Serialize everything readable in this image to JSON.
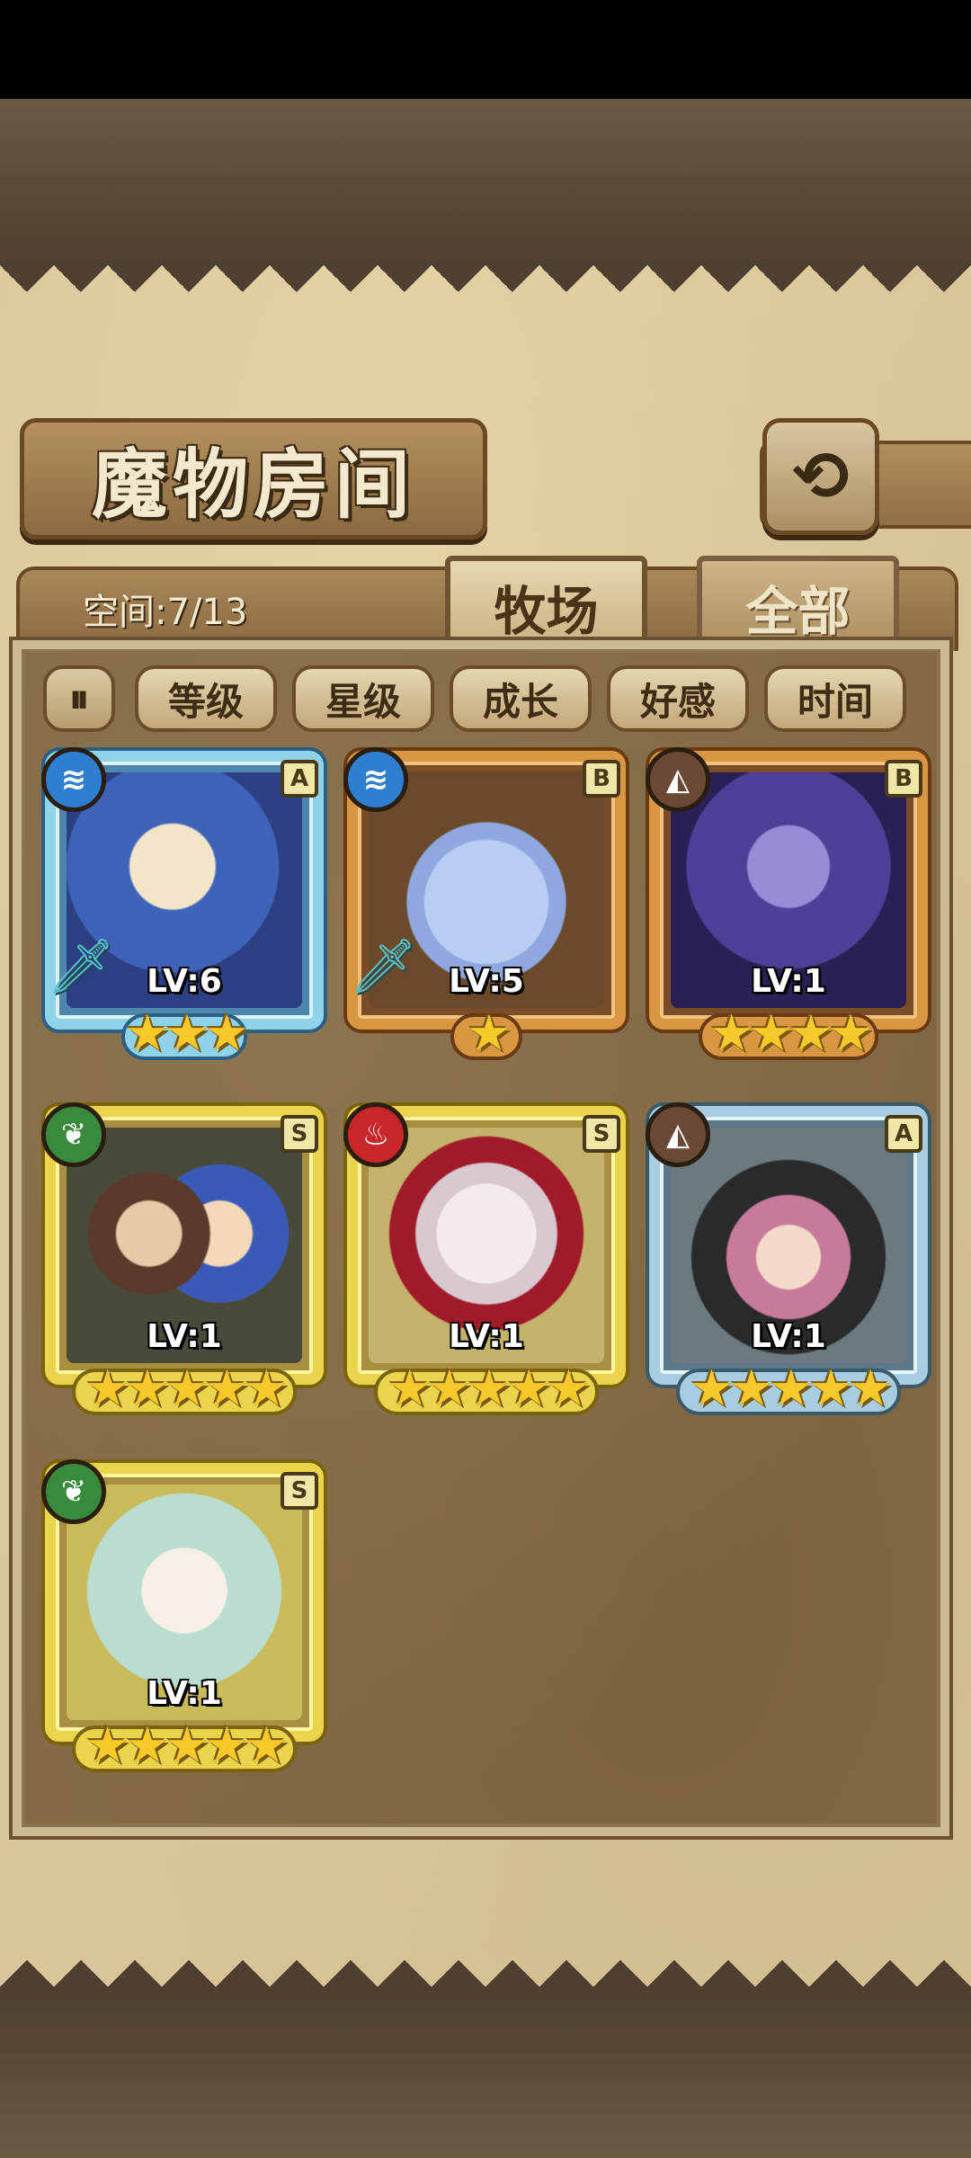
{
  "screen": {
    "title": "魔物房间",
    "back_icon": "⟲",
    "space_label": "空间:7/13"
  },
  "tabs": [
    {
      "label": "牧场",
      "active": true
    },
    {
      "label": "全部",
      "active": false
    }
  ],
  "sort": {
    "toggle_icon": "⏸",
    "buttons": [
      "等级",
      "星级",
      "成长",
      "好感",
      "时间"
    ]
  },
  "cards": [
    {
      "level": "LV:6",
      "rank": "A",
      "element": "water",
      "element_icon": "≋",
      "stars": 3,
      "frame": "blue",
      "has_weapon": true
    },
    {
      "level": "LV:5",
      "rank": "B",
      "element": "water",
      "element_icon": "≋",
      "stars": 1,
      "frame": "bronze",
      "has_weapon": true
    },
    {
      "level": "LV:1",
      "rank": "B",
      "element": "earth",
      "element_icon": "◭",
      "stars": 4,
      "frame": "bronze",
      "has_weapon": false
    },
    {
      "level": "LV:1",
      "rank": "S",
      "element": "wood",
      "element_icon": "❦",
      "stars": 5,
      "frame": "gold",
      "has_weapon": false
    },
    {
      "level": "LV:1",
      "rank": "S",
      "element": "fire",
      "element_icon": "♨",
      "stars": 5,
      "frame": "gold",
      "has_weapon": false
    },
    {
      "level": "LV:1",
      "rank": "A",
      "element": "earth",
      "element_icon": "◭",
      "stars": 5,
      "frame": "steel",
      "has_weapon": false
    },
    {
      "level": "LV:1",
      "rank": "S",
      "element": "wood",
      "element_icon": "❦",
      "stars": 5,
      "frame": "gold",
      "has_weapon": false
    }
  ],
  "colors": {
    "star": "#f7c92a",
    "water": "#2f7fd0",
    "earth": "#6a4a34",
    "wood": "#3a8a3e",
    "fire": "#c8262a"
  }
}
